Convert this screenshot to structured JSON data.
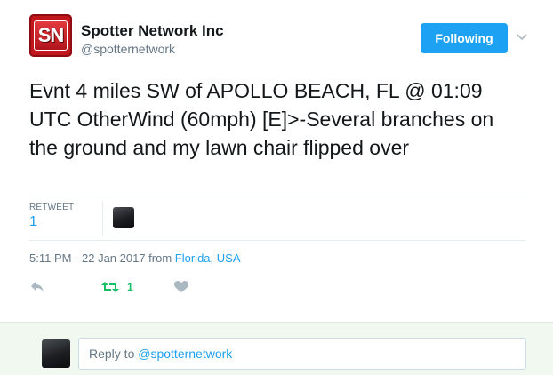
{
  "author": {
    "avatar_text": "SN",
    "name": "Spotter Network Inc",
    "handle": "@spotternetwork"
  },
  "follow_button": {
    "label": "Following"
  },
  "tweet": {
    "text": "Evnt 4 miles SW of APOLLO BEACH, FL @ 01:09 UTC OtherWind (60mph) [E]>-Several branches on the ground and my lawn chair flipped over"
  },
  "stats": {
    "retweet_label": "RETWEET",
    "retweet_count": "1"
  },
  "meta": {
    "time": "5:11 PM - 22 Jan 2017 from ",
    "location": "Florida, USA"
  },
  "actions": {
    "reply_icon": "reply-icon",
    "retweet_icon": "retweet-icon",
    "retweet_count": "1",
    "like_icon": "heart-icon"
  },
  "reply_box": {
    "prefix": "Reply to ",
    "mention": "@spotternetwork"
  },
  "colors": {
    "brand_blue": "#1da1f2",
    "retweet_green": "#17bf63",
    "muted_gray": "#657786",
    "avatar_red": "#c2161d"
  }
}
